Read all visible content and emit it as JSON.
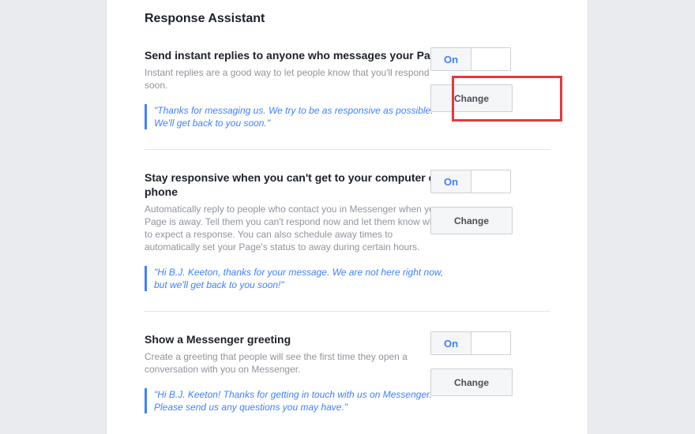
{
  "page": {
    "title": "Response Assistant"
  },
  "sections": [
    {
      "title": "Send instant replies to anyone who messages your Page",
      "description": "Instant replies are a good way to let people know that you'll respond soon.",
      "quote": "\"Thanks for messaging us. We try to be as responsive as possible. We'll get back to you soon.\"",
      "toggle_label": "On",
      "change_label": "Change"
    },
    {
      "title": "Stay responsive when you can't get to your computer or phone",
      "description": "Automatically reply to people who contact you in Messenger when your Page is away. Tell them you can't respond now and let them know when to expect a response. You can also schedule away times to automatically set your Page's status to away during certain hours.",
      "quote": "\"Hi B.J. Keeton, thanks for your message. We are not here right now, but we'll get back to you soon!\"",
      "toggle_label": "On",
      "change_label": "Change"
    },
    {
      "title": "Show a Messenger greeting",
      "description": "Create a greeting that people will see the first time they open a conversation with you on Messenger.",
      "quote": "\"Hi B.J. Keeton! Thanks for getting in touch with us on Messenger. Please send us any questions you may have.\"",
      "toggle_label": "On",
      "change_label": "Change"
    }
  ],
  "colors": {
    "accent": "#4080ff",
    "highlight_box": "#e8373d"
  }
}
